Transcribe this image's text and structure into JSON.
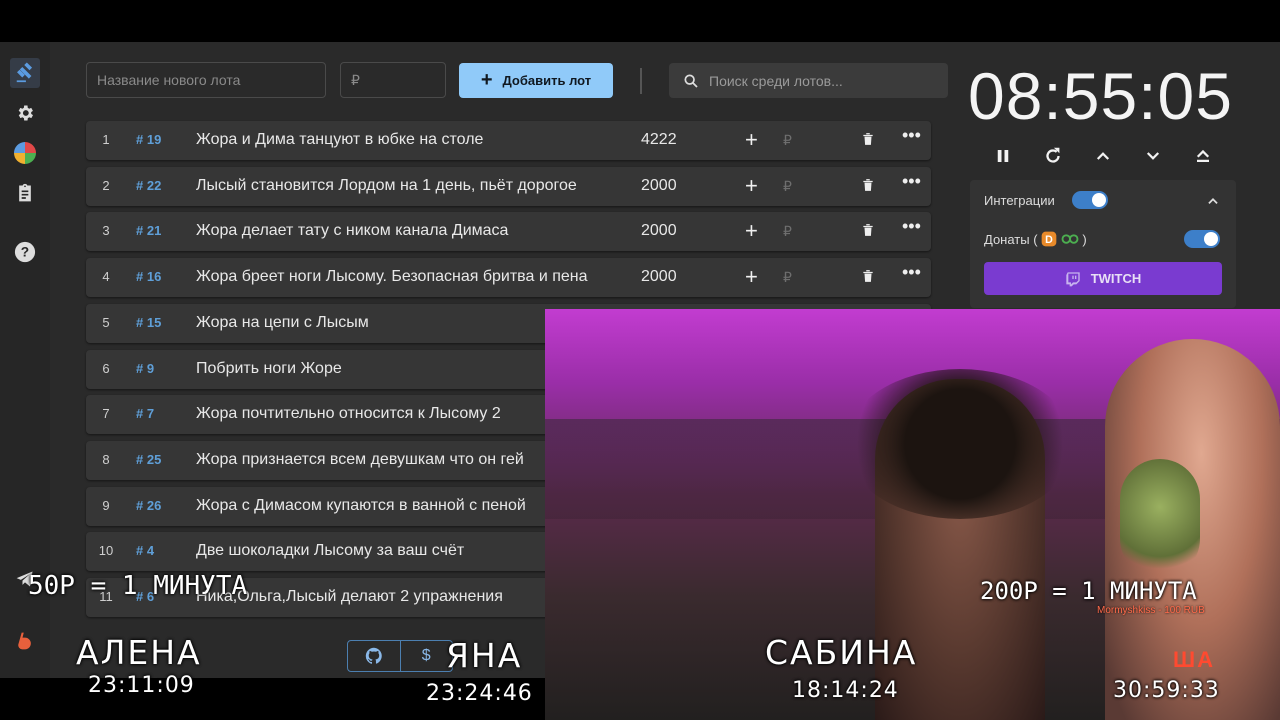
{
  "form": {
    "name_placeholder": "Название нового лота",
    "amount_placeholder": "₽",
    "add_label": "Добавить лот",
    "search_placeholder": "Поиск среди лотов..."
  },
  "lots": [
    {
      "num": "1",
      "id": "19",
      "name": "Жора и Дима танцуют в юбке на столе",
      "amount": "4222"
    },
    {
      "num": "2",
      "id": "22",
      "name": "Лысый становится Лордом на 1 день, пьёт дорогое",
      "amount": "2000"
    },
    {
      "num": "3",
      "id": "21",
      "name": "Жора делает тату с ником канала Димаса",
      "amount": "2000"
    },
    {
      "num": "4",
      "id": "16",
      "name": "Жора бреет ноги Лысому. Безопасная бритва и пена",
      "amount": "2000"
    },
    {
      "num": "5",
      "id": "15",
      "name": "Жора на цепи с Лысым",
      "amount": ""
    },
    {
      "num": "6",
      "id": "9",
      "name": "Побрить ноги Жоре",
      "amount": ""
    },
    {
      "num": "7",
      "id": "7",
      "name": "Жора почтительно относится к Лысому 2",
      "amount": ""
    },
    {
      "num": "8",
      "id": "25",
      "name": "Жора признается всем девушкам что он гей",
      "amount": ""
    },
    {
      "num": "9",
      "id": "26",
      "name": "Жора с Димасом купаются в ванной с пеной",
      "amount": ""
    },
    {
      "num": "10",
      "id": "4",
      "name": "Две шоколадки Лысому за ваш счёт",
      "amount": ""
    },
    {
      "num": "11",
      "id": "6",
      "name": "Ника,Ольга,Лысый делают 2 упражнения",
      "amount": ""
    }
  ],
  "timer": {
    "value": "08:55:05"
  },
  "integrations": {
    "title": "Интеграции",
    "donations_label": "Донаты (",
    "donations_close": ")",
    "twitch_label": "TWITCH"
  },
  "bottom_buttons": {
    "github": "github-icon",
    "donate": "$"
  },
  "overlays": {
    "rate_left": "50Р = 1 МИНУТА",
    "rate_right": "200Р = 1 МИНУТА",
    "people": [
      {
        "name": "АЛЕНА",
        "time": "23:11:09"
      },
      {
        "name": "ЯНА",
        "time": "23:24:46"
      },
      {
        "name": "САБИНА",
        "time": "18:14:24"
      },
      {
        "name": "",
        "time": "30:59:33"
      }
    ],
    "donation_alert": "Mormyshkiss - 100 RUB"
  },
  "colors": {
    "accent": "#90caf9",
    "twitch": "#7a3bd0",
    "id_blue": "#5f9fd8",
    "switch_on": "#3d7fc9"
  }
}
